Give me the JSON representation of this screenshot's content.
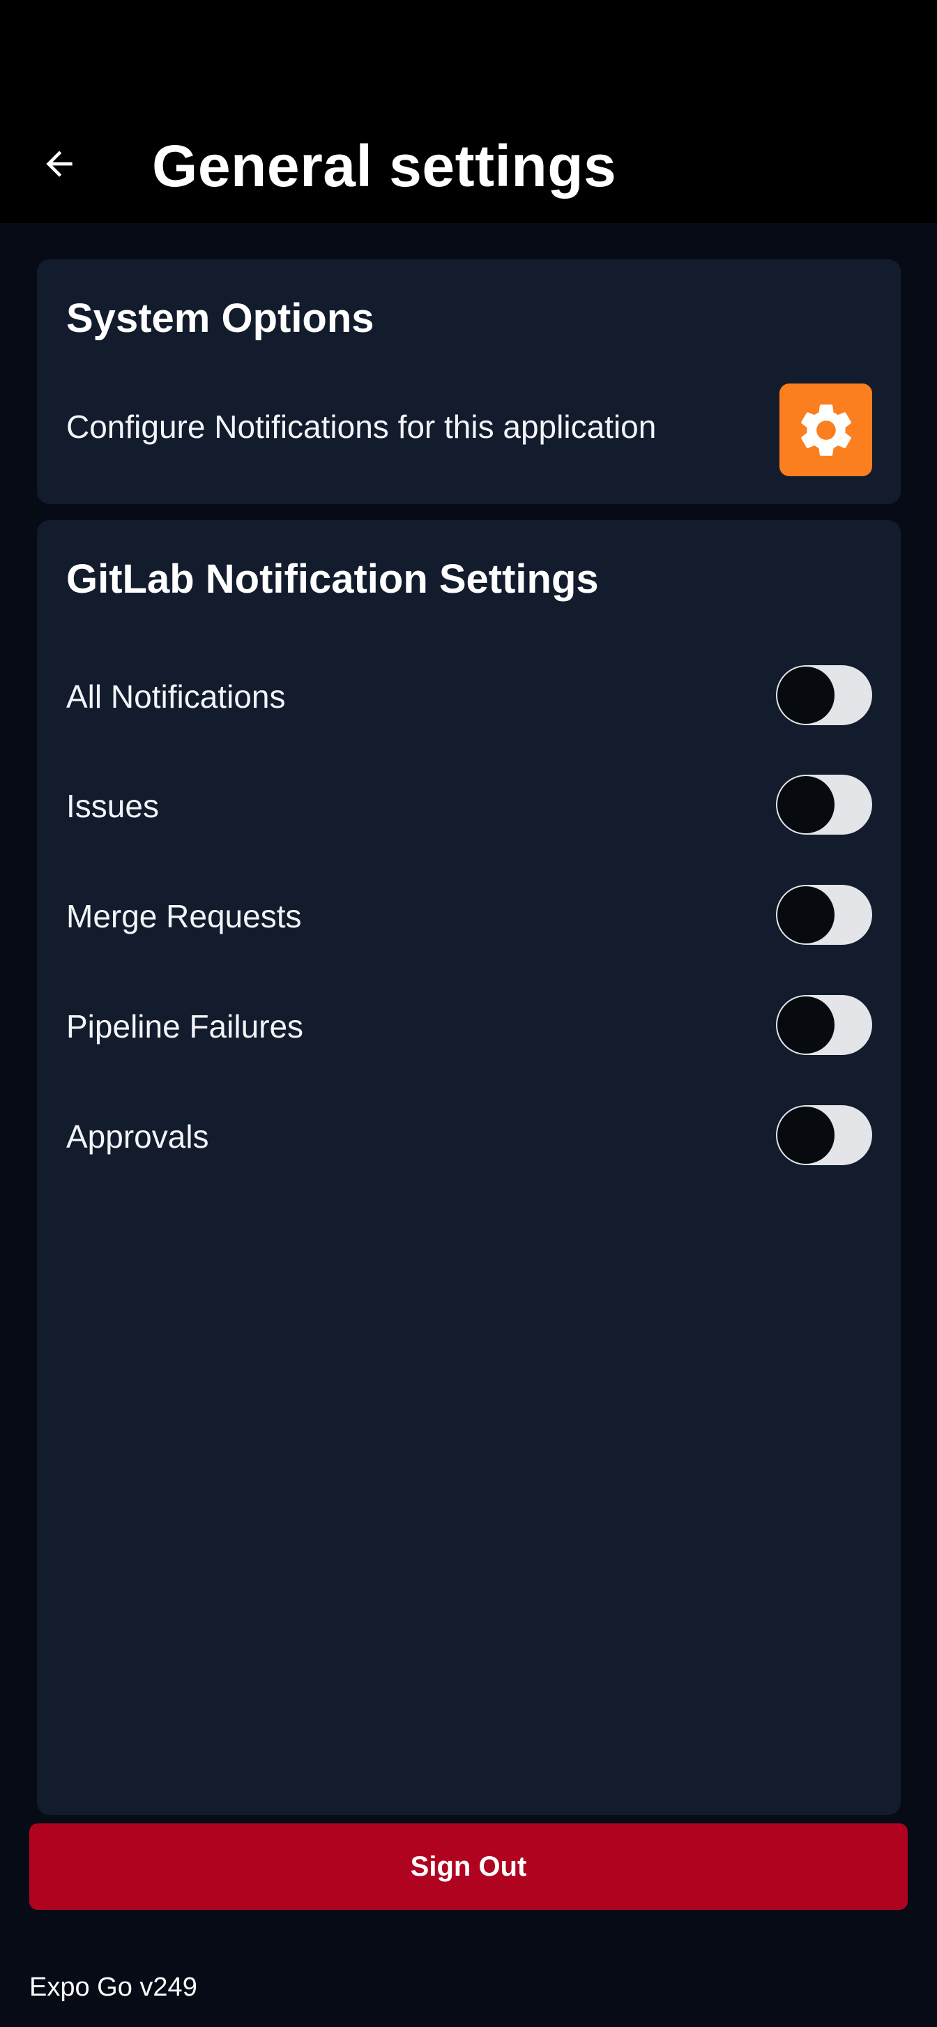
{
  "header": {
    "title": "General settings",
    "back_icon": "arrow-left-icon"
  },
  "system_options": {
    "title": "System Options",
    "configure_label": "Configure Notifications for this application",
    "configure_icon": "gear-icon",
    "configure_icon_bg": "#fb7f1e"
  },
  "gitlab_settings": {
    "title": "GitLab Notification Settings",
    "toggles": [
      {
        "label": "All Notifications",
        "on": false
      },
      {
        "label": "Issues",
        "on": false
      },
      {
        "label": "Merge Requests",
        "on": false
      },
      {
        "label": "Pipeline Failures",
        "on": false
      },
      {
        "label": "Approvals",
        "on": false
      }
    ]
  },
  "sign_out": {
    "label": "Sign Out",
    "color": "#b0031f"
  },
  "footer": {
    "version": "Expo Go v249"
  },
  "colors": {
    "background": "#060b16",
    "card": "#121c2d",
    "header": "#000000"
  }
}
